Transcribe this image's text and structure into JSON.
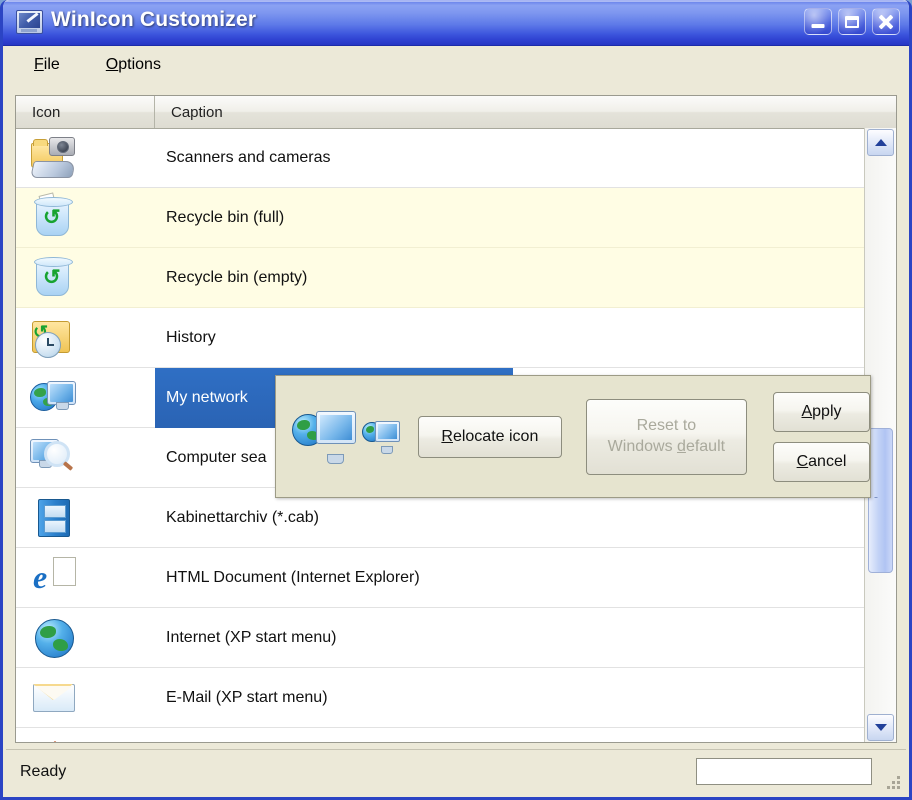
{
  "window": {
    "title": "WinIcon Customizer",
    "icon": "monitor-pencil-icon",
    "controls": {
      "minimize": "minimize-button",
      "maximize": "maximize-button",
      "close": "close-button"
    }
  },
  "menu": {
    "items": [
      {
        "label": "File",
        "accel": "F"
      },
      {
        "label": "Options",
        "accel": "O"
      }
    ]
  },
  "list": {
    "columns": [
      {
        "key": "icon",
        "label": "Icon"
      },
      {
        "key": "caption",
        "label": "Caption"
      }
    ],
    "rows": [
      {
        "caption": "Scanners and cameras",
        "icon": "scanners-cameras-icon",
        "state": "normal"
      },
      {
        "caption": "Recycle bin (full)",
        "icon": "recycle-bin-full-icon",
        "state": "modified"
      },
      {
        "caption": "Recycle bin (empty)",
        "icon": "recycle-bin-empty-icon",
        "state": "modified"
      },
      {
        "caption": "History",
        "icon": "history-icon",
        "state": "normal"
      },
      {
        "caption": "My network",
        "icon": "my-network-icon",
        "state": "selected"
      },
      {
        "caption": "Computer sea",
        "icon": "computer-search-icon",
        "state": "normal"
      },
      {
        "caption": "Kabinettarchiv (*.cab)",
        "icon": "cab-archive-icon",
        "state": "normal"
      },
      {
        "caption": "HTML Document (Internet Explorer)",
        "icon": "html-document-icon",
        "state": "normal"
      },
      {
        "caption": "Internet (XP start menu)",
        "icon": "internet-globe-icon",
        "state": "normal"
      },
      {
        "caption": "E-Mail (XP start menu)",
        "icon": "email-envelope-icon",
        "state": "normal"
      },
      {
        "caption": "",
        "icon": "home-roof-icon",
        "state": "normal"
      }
    ]
  },
  "scrollbar": {
    "up_arrow": "scroll-up-arrow",
    "down_arrow": "scroll-down-arrow",
    "thumb": "scroll-thumb"
  },
  "popup": {
    "preview_large_icon": "my-network-large-icon",
    "preview_small_icon": "my-network-small-icon",
    "relocate": {
      "label_pre": "R",
      "label_post": "elocate icon"
    },
    "reset": {
      "line1": "Reset to",
      "line2_pre": "Windows ",
      "line2_accel": "d",
      "line2_post": "efault",
      "disabled": true
    },
    "apply": {
      "accel": "A",
      "rest": "pply"
    },
    "cancel": {
      "accel": "C",
      "rest": "ancel"
    }
  },
  "statusbar": {
    "text": "Ready",
    "panel_value": ""
  },
  "colors": {
    "title_blue": "#2f44cf",
    "selection_blue": "#2f6fc4",
    "modified_row": "#fffde4",
    "popup_bg": "#e6e4cf",
    "face": "#ece9d8"
  }
}
